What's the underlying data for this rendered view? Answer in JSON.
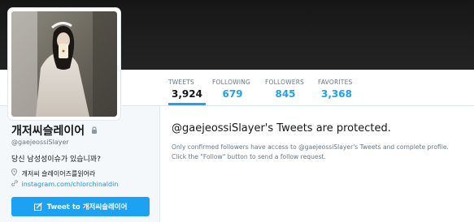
{
  "nav": {
    "tweets": {
      "label": "TWEETS",
      "value": "3,924"
    },
    "following": {
      "label": "FOLLOWING",
      "value": "679"
    },
    "followers": {
      "label": "FOLLOWERS",
      "value": "845"
    },
    "favorites": {
      "label": "FAVORITES",
      "value": "3,368"
    }
  },
  "profile": {
    "name": "개저씨슬레이어",
    "handle": "@gaejeossiSlayer",
    "bio": "당신 남성성이슈가 있습니꽈?",
    "location": "개저씨 슬레이어즈를읽어라",
    "url": "instagram.com/chlorchinaldin",
    "tweet_to_label": "Tweet to 개저씨슬레이어"
  },
  "protected": {
    "title": "@gaejeossiSlayer's Tweets are protected.",
    "line1": "Only confirmed followers have access to @gaejeossiSlayer's Tweets and complete profile.",
    "line2": "Click the \"Follow\" button to send a follow request."
  },
  "icons": {
    "lock": "lock-icon",
    "location": "map-pin-icon",
    "link": "link-icon",
    "compose": "compose-icon"
  },
  "colors": {
    "accent": "#1da1f2",
    "link": "#1b95e0",
    "text": "#14171a",
    "muted": "#657786"
  }
}
